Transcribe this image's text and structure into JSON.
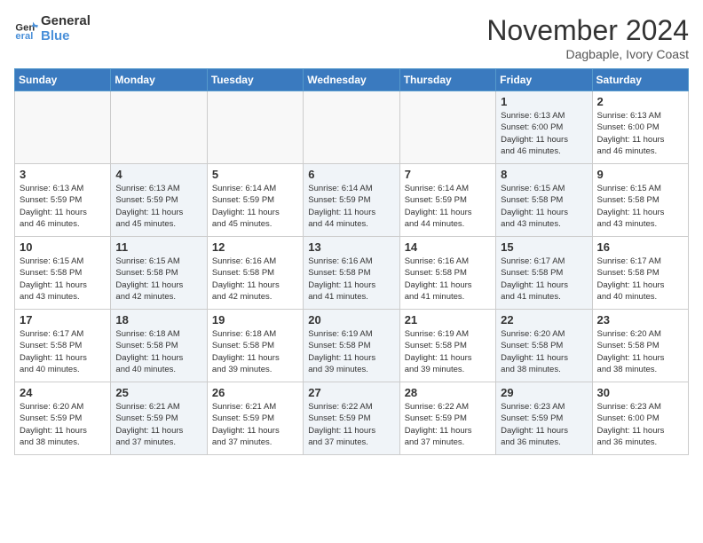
{
  "header": {
    "logo_line1": "General",
    "logo_line2": "Blue",
    "month": "November 2024",
    "location": "Dagbaple, Ivory Coast"
  },
  "weekdays": [
    "Sunday",
    "Monday",
    "Tuesday",
    "Wednesday",
    "Thursday",
    "Friday",
    "Saturday"
  ],
  "weeks": [
    [
      {
        "day": "",
        "info": "",
        "empty": true
      },
      {
        "day": "",
        "info": "",
        "empty": true
      },
      {
        "day": "",
        "info": "",
        "empty": true
      },
      {
        "day": "",
        "info": "",
        "empty": true
      },
      {
        "day": "",
        "info": "",
        "empty": true
      },
      {
        "day": "1",
        "info": "Sunrise: 6:13 AM\nSunset: 6:00 PM\nDaylight: 11 hours\nand 46 minutes.",
        "shaded": true
      },
      {
        "day": "2",
        "info": "Sunrise: 6:13 AM\nSunset: 6:00 PM\nDaylight: 11 hours\nand 46 minutes.",
        "shaded": false
      }
    ],
    [
      {
        "day": "3",
        "info": "Sunrise: 6:13 AM\nSunset: 5:59 PM\nDaylight: 11 hours\nand 46 minutes.",
        "shaded": false
      },
      {
        "day": "4",
        "info": "Sunrise: 6:13 AM\nSunset: 5:59 PM\nDaylight: 11 hours\nand 45 minutes.",
        "shaded": true
      },
      {
        "day": "5",
        "info": "Sunrise: 6:14 AM\nSunset: 5:59 PM\nDaylight: 11 hours\nand 45 minutes.",
        "shaded": false
      },
      {
        "day": "6",
        "info": "Sunrise: 6:14 AM\nSunset: 5:59 PM\nDaylight: 11 hours\nand 44 minutes.",
        "shaded": true
      },
      {
        "day": "7",
        "info": "Sunrise: 6:14 AM\nSunset: 5:59 PM\nDaylight: 11 hours\nand 44 minutes.",
        "shaded": false
      },
      {
        "day": "8",
        "info": "Sunrise: 6:15 AM\nSunset: 5:58 PM\nDaylight: 11 hours\nand 43 minutes.",
        "shaded": true
      },
      {
        "day": "9",
        "info": "Sunrise: 6:15 AM\nSunset: 5:58 PM\nDaylight: 11 hours\nand 43 minutes.",
        "shaded": false
      }
    ],
    [
      {
        "day": "10",
        "info": "Sunrise: 6:15 AM\nSunset: 5:58 PM\nDaylight: 11 hours\nand 43 minutes.",
        "shaded": false
      },
      {
        "day": "11",
        "info": "Sunrise: 6:15 AM\nSunset: 5:58 PM\nDaylight: 11 hours\nand 42 minutes.",
        "shaded": true
      },
      {
        "day": "12",
        "info": "Sunrise: 6:16 AM\nSunset: 5:58 PM\nDaylight: 11 hours\nand 42 minutes.",
        "shaded": false
      },
      {
        "day": "13",
        "info": "Sunrise: 6:16 AM\nSunset: 5:58 PM\nDaylight: 11 hours\nand 41 minutes.",
        "shaded": true
      },
      {
        "day": "14",
        "info": "Sunrise: 6:16 AM\nSunset: 5:58 PM\nDaylight: 11 hours\nand 41 minutes.",
        "shaded": false
      },
      {
        "day": "15",
        "info": "Sunrise: 6:17 AM\nSunset: 5:58 PM\nDaylight: 11 hours\nand 41 minutes.",
        "shaded": true
      },
      {
        "day": "16",
        "info": "Sunrise: 6:17 AM\nSunset: 5:58 PM\nDaylight: 11 hours\nand 40 minutes.",
        "shaded": false
      }
    ],
    [
      {
        "day": "17",
        "info": "Sunrise: 6:17 AM\nSunset: 5:58 PM\nDaylight: 11 hours\nand 40 minutes.",
        "shaded": false
      },
      {
        "day": "18",
        "info": "Sunrise: 6:18 AM\nSunset: 5:58 PM\nDaylight: 11 hours\nand 40 minutes.",
        "shaded": true
      },
      {
        "day": "19",
        "info": "Sunrise: 6:18 AM\nSunset: 5:58 PM\nDaylight: 11 hours\nand 39 minutes.",
        "shaded": false
      },
      {
        "day": "20",
        "info": "Sunrise: 6:19 AM\nSunset: 5:58 PM\nDaylight: 11 hours\nand 39 minutes.",
        "shaded": true
      },
      {
        "day": "21",
        "info": "Sunrise: 6:19 AM\nSunset: 5:58 PM\nDaylight: 11 hours\nand 39 minutes.",
        "shaded": false
      },
      {
        "day": "22",
        "info": "Sunrise: 6:20 AM\nSunset: 5:58 PM\nDaylight: 11 hours\nand 38 minutes.",
        "shaded": true
      },
      {
        "day": "23",
        "info": "Sunrise: 6:20 AM\nSunset: 5:58 PM\nDaylight: 11 hours\nand 38 minutes.",
        "shaded": false
      }
    ],
    [
      {
        "day": "24",
        "info": "Sunrise: 6:20 AM\nSunset: 5:59 PM\nDaylight: 11 hours\nand 38 minutes.",
        "shaded": false
      },
      {
        "day": "25",
        "info": "Sunrise: 6:21 AM\nSunset: 5:59 PM\nDaylight: 11 hours\nand 37 minutes.",
        "shaded": true
      },
      {
        "day": "26",
        "info": "Sunrise: 6:21 AM\nSunset: 5:59 PM\nDaylight: 11 hours\nand 37 minutes.",
        "shaded": false
      },
      {
        "day": "27",
        "info": "Sunrise: 6:22 AM\nSunset: 5:59 PM\nDaylight: 11 hours\nand 37 minutes.",
        "shaded": true
      },
      {
        "day": "28",
        "info": "Sunrise: 6:22 AM\nSunset: 5:59 PM\nDaylight: 11 hours\nand 37 minutes.",
        "shaded": false
      },
      {
        "day": "29",
        "info": "Sunrise: 6:23 AM\nSunset: 5:59 PM\nDaylight: 11 hours\nand 36 minutes.",
        "shaded": true
      },
      {
        "day": "30",
        "info": "Sunrise: 6:23 AM\nSunset: 6:00 PM\nDaylight: 11 hours\nand 36 minutes.",
        "shaded": false
      }
    ]
  ]
}
